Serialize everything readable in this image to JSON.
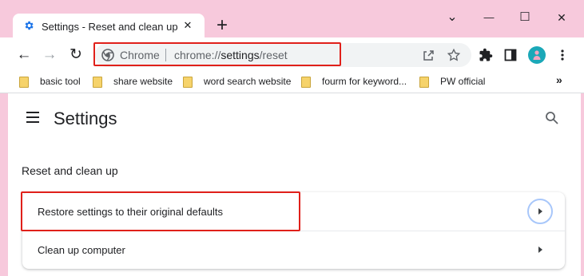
{
  "tab": {
    "title": "Settings - Reset and clean up",
    "close": "✕",
    "new_tab": "+"
  },
  "window_controls": {
    "minimize": "—",
    "maximize": "☐",
    "close": "✕",
    "dropdown": "⌄"
  },
  "toolbar": {
    "back": "←",
    "forward": "→",
    "reload": "↻",
    "omnibox_site": "Chrome",
    "url_prefix": "chrome://",
    "url_path": "settings",
    "url_suffix": "/reset",
    "icons": [
      "share-icon",
      "star-icon",
      "extensions-icon",
      "side-panel-icon",
      "profile-avatar",
      "more-menu-icon"
    ]
  },
  "bookmarks": [
    {
      "label": "basic tool"
    },
    {
      "label": "share website"
    },
    {
      "label": "word search website"
    },
    {
      "label": "fourm for keyword..."
    },
    {
      "label": "PW official"
    }
  ],
  "bookmarks_more": "»",
  "settings": {
    "title": "Settings",
    "section_title": "Reset and clean up",
    "rows": [
      {
        "label": "Restore settings to their original defaults"
      },
      {
        "label": "Clean up computer"
      }
    ]
  },
  "colors": {
    "frame": "#f7c9dc",
    "highlight": "#e0201a",
    "accent": "#1a73e8",
    "text": "#202124"
  }
}
